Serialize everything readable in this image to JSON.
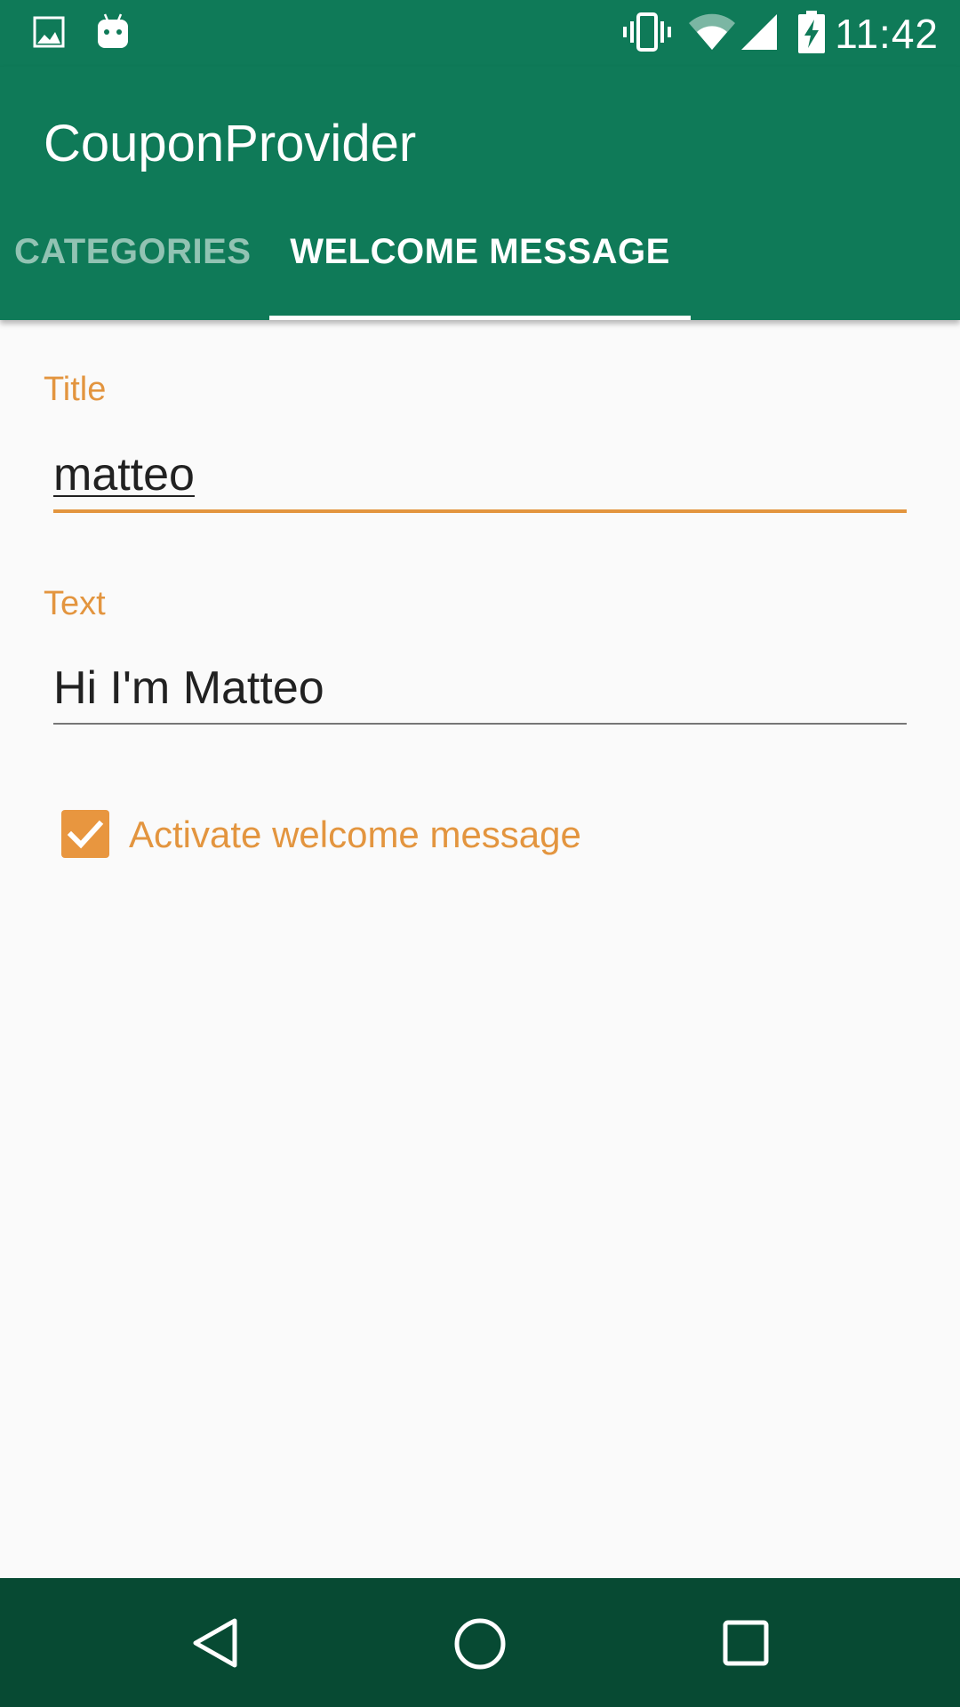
{
  "status_bar": {
    "time": "11:42",
    "icons": [
      "image-icon",
      "android-icon",
      "vibrate-icon",
      "wifi-icon",
      "signal-icon",
      "battery-charging-icon"
    ]
  },
  "app_bar": {
    "title": "CouponProvider",
    "tabs": [
      {
        "label": "CATEGORIES",
        "selected": false
      },
      {
        "label": "WELCOME MESSAGE",
        "selected": true
      }
    ]
  },
  "form": {
    "title_field": {
      "label": "Title",
      "value": "matteo",
      "focused": true
    },
    "text_field": {
      "label": "Text",
      "value": "Hi I'm Matteo",
      "focused": false
    },
    "activate_checkbox": {
      "label": "Activate welcome message",
      "checked": true
    }
  },
  "nav_bar": {
    "icons": [
      "back-icon",
      "home-icon",
      "recents-icon"
    ]
  },
  "colors": {
    "primary": "#0f7a58",
    "primary_dark": "#074a33",
    "accent": "#e3953f",
    "background": "#fafafa"
  }
}
